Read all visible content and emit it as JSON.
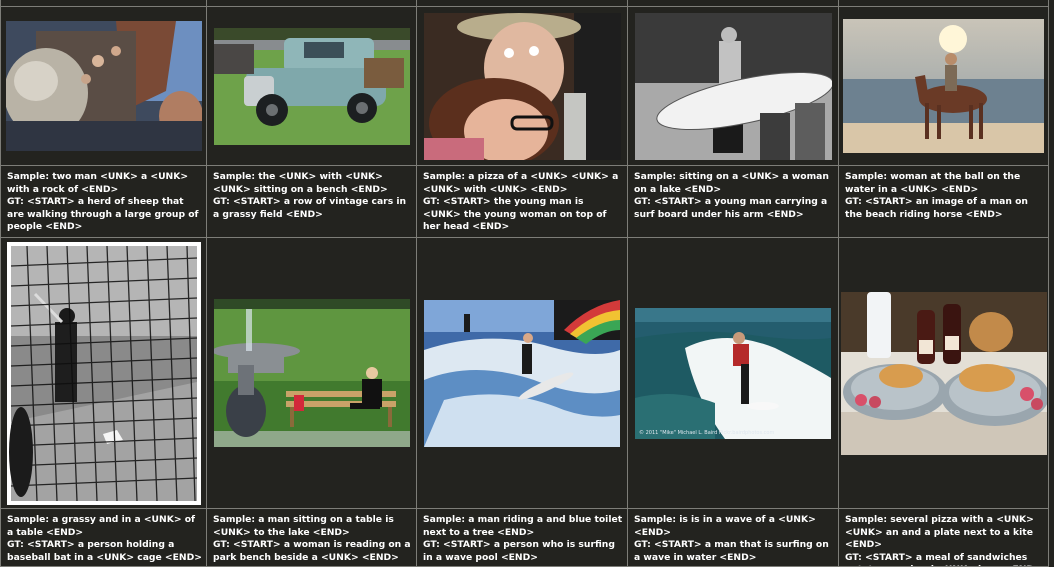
{
  "grid": {
    "row1": [
      {
        "image": "old-man-photo",
        "sample": "Sample: two man <UNK> a <UNK> with a rock of <END>",
        "gt": "GT: <START> a herd of sheep that are walking through a large group of people <END>"
      },
      {
        "image": "vintage-truck-photo",
        "sample": "Sample: the <UNK> with <UNK> <UNK> sitting on a bench <END>",
        "gt": "GT: <START> a row of vintage cars in a grassy field <END>"
      },
      {
        "image": "couple-selfie-photo",
        "sample": "Sample: a pizza of a <UNK> <UNK> a <UNK> with <UNK> <END>",
        "gt": "GT: <START> the young man is <UNK> the young woman on top of her head <END>"
      },
      {
        "image": "surfer-beach-photo",
        "sample": "Sample: sitting on a <UNK> a woman on a lake <END>",
        "gt": "GT: <START> a young man carrying a surf board under his arm <END>"
      },
      {
        "image": "horse-rider-beach-photo",
        "sample": "Sample: woman at the ball on the water in a <UNK> <END>",
        "gt": "GT: <START> an image of a man on the beach riding horse <END>"
      }
    ],
    "row2": [
      {
        "image": "batting-cage-photo",
        "sample": "Sample: a grassy and in a <UNK> of a table <END>",
        "gt": "GT: <START> a person holding a baseball bat in a <UNK> cage <END>"
      },
      {
        "image": "park-bench-reader-photo",
        "sample": "Sample: a man sitting on a table is <UNK> to the lake <END>",
        "gt": "GT: <START> a woman is reading on a park bench beside a <UNK> <END>"
      },
      {
        "image": "wave-pool-surfer-photo",
        "sample": "Sample: a man riding a and blue toilet next to a tree <END>",
        "gt": "GT: <START> a person who is surfing in a wave pool <END>"
      },
      {
        "image": "ocean-surfer-photo",
        "sample": "Sample: is is in a wave of a <UNK> <END>",
        "gt": "GT: <START> a man that is surfing on a wave in water <END>",
        "photo_credit": "© 2011 \"Mike\" Michael L. Baird flickr.bairdphotos.com"
      },
      {
        "image": "sandwich-plates-photo",
        "sample": "Sample: several pizza with a <UNK> <UNK> an and a plate next to a kite <END>",
        "gt": "GT: <START> a meal of sandwiches potatoes and red <UNK> beer <END>"
      }
    ]
  },
  "colors": {
    "background": "#23231f",
    "grid_line": "#7d7d78",
    "text": "#ffffff"
  }
}
